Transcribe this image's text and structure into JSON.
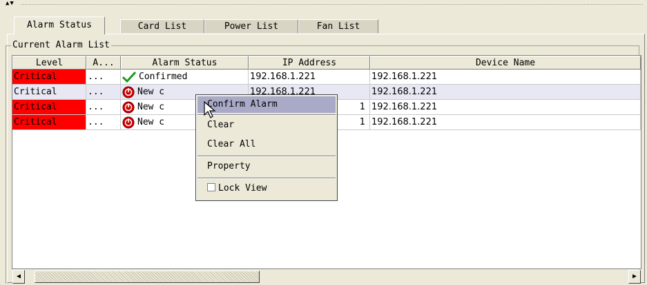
{
  "top_strip": {
    "arrows": "▲▼"
  },
  "tabs": [
    {
      "label": "Alarm Status",
      "active": true
    },
    {
      "label": "Card List",
      "active": false
    },
    {
      "label": "Power List",
      "active": false
    },
    {
      "label": "Fan List",
      "active": false
    }
  ],
  "group": {
    "title": "Current Alarm List"
  },
  "table": {
    "columns": [
      "Level",
      "A...",
      "Alarm Status",
      "IP Address",
      "Device Name"
    ],
    "rows": [
      {
        "level": "Critical",
        "level_bg": "#ff0000",
        "a": "...",
        "status_icon": "check-icon",
        "status": "Confirmed",
        "ip": "192.168.1.221",
        "device": "192.168.1.221"
      },
      {
        "level": "Critical",
        "level_bg": "#ffffff",
        "a": "...",
        "status_icon": "alarm-red-icon",
        "status": "New c",
        "ip": "192.168.1.221",
        "device": "192.168.1.221"
      },
      {
        "level": "Critical",
        "level_bg": "#ff0000",
        "a": "...",
        "status_icon": "alarm-red-icon",
        "status": "New c",
        "ip": "1",
        "device": "192.168.1.221"
      },
      {
        "level": "Critical",
        "level_bg": "#ff0000",
        "a": "...",
        "status_icon": "alarm-red-icon",
        "status": "New c",
        "ip": "1",
        "device": "192.168.1.221"
      }
    ]
  },
  "context_menu": {
    "items": [
      {
        "label": "Confirm Alarm",
        "highlighted": true
      },
      {
        "label": "Clear"
      },
      {
        "label": "Clear All"
      },
      {
        "label": "Property"
      },
      {
        "label": "Lock View",
        "checkbox": true,
        "checked": false
      }
    ]
  },
  "colors": {
    "critical": "#ff0000",
    "selected_row": "#e8e8f4",
    "menu_highlight": "#a9a9c8",
    "window_bg": "#ece9d8"
  },
  "icons": {
    "scroll_left": "arrow-left-icon",
    "scroll_right": "arrow-right-icon",
    "cursor": "mouse-pointer-icon"
  }
}
